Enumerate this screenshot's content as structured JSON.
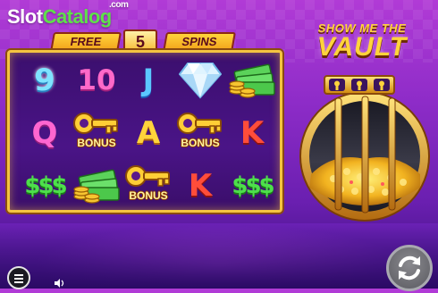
{
  "watermark": {
    "part1": "Slot",
    "part2": "Catalog",
    "suffix": ".com"
  },
  "free_spins": {
    "label_left": "FREE",
    "count": "5",
    "label_right": "SPINS"
  },
  "game_title": {
    "line1": "SHOW ME THE",
    "line2": "VAULT"
  },
  "reels": {
    "grid": [
      [
        "9",
        "10",
        "J",
        "diamond",
        "cash-stack"
      ],
      [
        "Q",
        "key-bonus",
        "A",
        "key-bonus",
        "K"
      ],
      [
        "$$$",
        "cash-stack",
        "key-bonus",
        "K",
        "$$$"
      ]
    ],
    "bonus_label": "BONUS"
  },
  "vault": {
    "locks": [
      "keyhole-icon",
      "keyhole-icon",
      "keyhole-icon"
    ]
  },
  "controls": {
    "menu": "menu-icon",
    "volume": "speaker-icon",
    "spin": "spin-icon"
  },
  "colors": {
    "reel_frame": "#f4c441",
    "reel_bg": "#4a1487",
    "accent": "#ffd43b",
    "bg": "#8e2cc8"
  }
}
